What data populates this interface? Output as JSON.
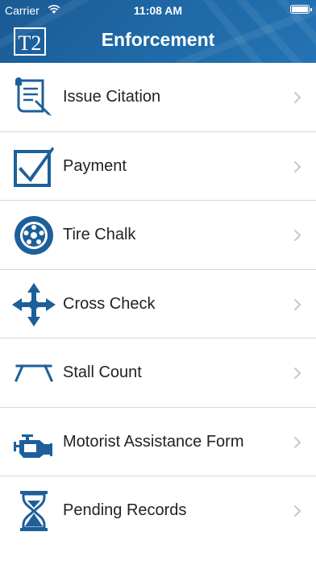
{
  "status_bar": {
    "carrier": "Carrier",
    "time": "11:08 AM",
    "battery_level": 1.0
  },
  "header": {
    "logo_text": "T2",
    "title": "Enforcement"
  },
  "menu": [
    {
      "label": "Issue Citation",
      "icon": "citation-scroll-icon"
    },
    {
      "label": "Payment",
      "icon": "checkbox-check-icon"
    },
    {
      "label": "Tire Chalk",
      "icon": "tire-icon"
    },
    {
      "label": "Cross Check",
      "icon": "cross-arrows-icon"
    },
    {
      "label": "Stall Count",
      "icon": "parking-stall-icon"
    },
    {
      "label": "Motorist Assistance Form",
      "icon": "car-engine-icon"
    },
    {
      "label": "Pending Records",
      "icon": "hourglass-icon"
    }
  ],
  "colors": {
    "brand": "#1f6aa8",
    "icon": "#1d5f9a",
    "chevron": "#c7c7cc"
  }
}
